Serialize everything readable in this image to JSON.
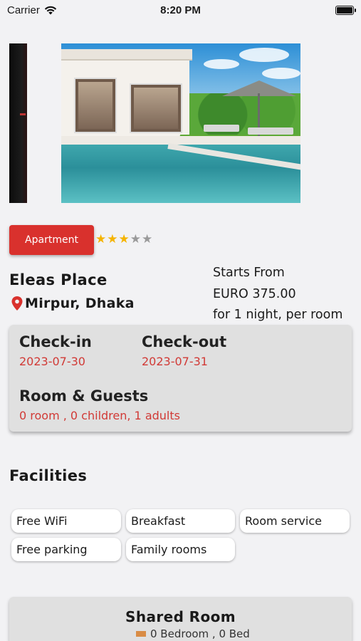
{
  "status_bar": {
    "carrier": "Carrier",
    "time": "8:20 PM",
    "battery_level": 1.0
  },
  "property": {
    "type_badge": "Apartment",
    "rating": 3,
    "rating_max": 5,
    "name": "Eleas Place",
    "location": "Mirpur, Dhaka"
  },
  "price": {
    "starts_label": "Starts From",
    "amount": "EURO 375.00",
    "unit": "for 1 night, per room"
  },
  "booking": {
    "checkin_label": "Check-in",
    "checkin_date": "2023-07-30",
    "checkout_label": "Check-out",
    "checkout_date": "2023-07-31",
    "guests_label": "Room & Guests",
    "guests_value": "0 room , 0 children, 1 adults"
  },
  "facilities": {
    "title": "Facilities",
    "items": [
      "Free WiFi",
      "Breakfast",
      "Room service",
      "Free parking",
      "Family rooms"
    ]
  },
  "room": {
    "title": "Shared Room",
    "detail": "0 Bedroom , 0 Bed"
  },
  "colors": {
    "accent": "#d9312d",
    "star": "#f5b400",
    "background": "#f2f2f4",
    "card": "#e0e0e0"
  },
  "icons": [
    "wifi-icon",
    "battery-icon",
    "location-pin-icon",
    "star-icon",
    "bed-icon"
  ]
}
